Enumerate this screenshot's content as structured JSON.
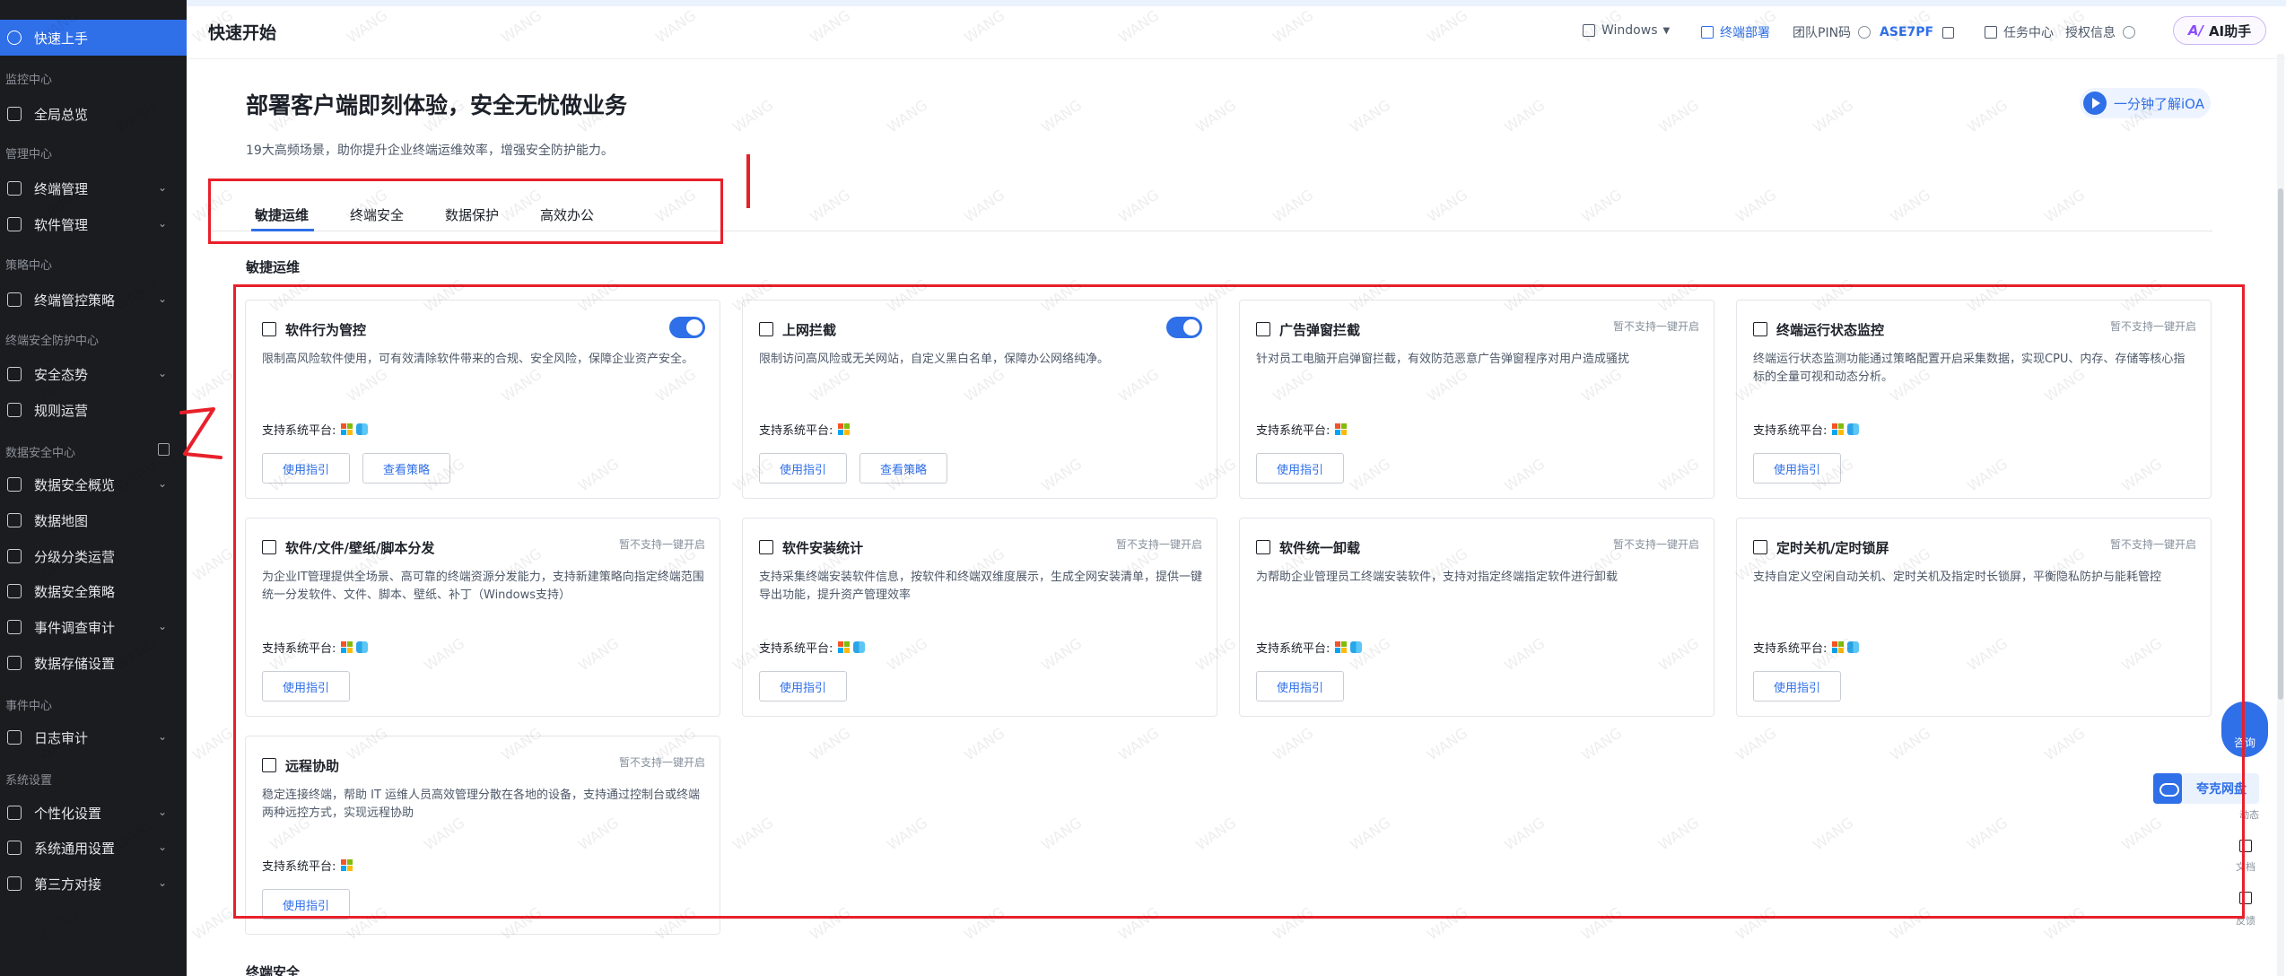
{
  "sidebar": {
    "groups": [
      "监控中心",
      "管理中心",
      "策略中心",
      "终端安全防护中心",
      "数据安全中心",
      "事件中心",
      "系统设置"
    ],
    "items": [
      {
        "label": "快速上手"
      },
      {
        "label": "全局总览"
      },
      {
        "label": "终端管理"
      },
      {
        "label": "软件管理"
      },
      {
        "label": "终端管控策略"
      },
      {
        "label": "安全态势"
      },
      {
        "label": "规则运营"
      },
      {
        "label": "数据安全概览"
      },
      {
        "label": "数据地图"
      },
      {
        "label": "分级分类运营"
      },
      {
        "label": "数据安全策略"
      },
      {
        "label": "事件调查审计"
      },
      {
        "label": "数据存储设置"
      },
      {
        "label": "日志审计"
      },
      {
        "label": "个性化设置"
      },
      {
        "label": "系统通用设置"
      },
      {
        "label": "第三方对接"
      }
    ]
  },
  "header": {
    "title": "快速开始",
    "os_select": "Windows",
    "deploy": "终端部署",
    "pin_label": "团队PIN码",
    "pin_value": "ASE7PF",
    "task_center": "任务中心",
    "license": "授权信息",
    "ai_logo": "A/",
    "ai_label": "AI助手"
  },
  "hero": {
    "title": "部署客户端即刻体验，安全无忧做业务",
    "subtitle": "19大高频场景，助你提升企业终端运维效率，增强安全防护能力。",
    "learn_button": "一分钟了解iOA"
  },
  "tabs": [
    {
      "label": "敏捷运维",
      "active": true
    },
    {
      "label": "终端安全",
      "active": false
    },
    {
      "label": "数据保护",
      "active": false
    },
    {
      "label": "高效办公",
      "active": false
    }
  ],
  "section": {
    "label": "敏捷运维",
    "next_label": "终端安全"
  },
  "common": {
    "platform_label": "支持系统平台:",
    "guide_button": "使用指引",
    "policy_button": "查看策略",
    "not_supported": "暂不支持一键开启"
  },
  "cards": [
    {
      "title": "软件行为管控",
      "desc": "限制高风险软件使用，可有效清除软件带来的合规、安全风险，保障企业资产安全。",
      "toggle": true,
      "mac": true,
      "policy": true
    },
    {
      "title": "上网拦截",
      "desc": "限制访问高风险或无关网站，自定义黑白名单，保障办公网络纯净。",
      "toggle": true,
      "mac": false,
      "policy": true
    },
    {
      "title": "广告弹窗拦截",
      "desc": "针对员工电脑开启弹窗拦截，有效防范恶意广告弹窗程序对用户造成骚扰",
      "toggle": false,
      "mac": false,
      "policy": false
    },
    {
      "title": "终端运行状态监控",
      "desc": "终端运行状态监测功能通过策略配置开启采集数据，实现CPU、内存、存储等核心指标的全量可视和动态分析。",
      "toggle": false,
      "mac": true,
      "policy": false
    },
    {
      "title": "软件/文件/壁纸/脚本分发",
      "desc": "为企业IT管理提供全场景、高可靠的终端资源分发能力，支持新建策略向指定终端范围统一分发软件、文件、脚本、壁纸、补丁（Windows支持）",
      "toggle": false,
      "mac": true,
      "policy": false
    },
    {
      "title": "软件安装统计",
      "desc": "支持采集终端安装软件信息，按软件和终端双维度展示，生成全网安装清单，提供一键导出功能，提升资产管理效率",
      "toggle": false,
      "mac": true,
      "policy": false
    },
    {
      "title": "软件统一卸载",
      "desc": "为帮助企业管理员工终端安装软件，支持对指定终端指定软件进行卸载",
      "toggle": false,
      "mac": true,
      "policy": false
    },
    {
      "title": "定时关机/定时锁屏",
      "desc": "支持自定义空闲自动关机、定时关机及指定时长锁屏，平衡隐私防护与能耗管控",
      "toggle": false,
      "mac": true,
      "policy": false
    },
    {
      "title": "远程协助",
      "desc": "稳定连接终端，帮助 IT 运维人员高效管理分散在各地的设备，支持通过控制台或终端两种远控方式，实现远程协助",
      "toggle": false,
      "mac": false,
      "policy": false
    }
  ],
  "floating": {
    "consult": "咨询",
    "cloud": "夸克网盘",
    "rail": [
      "动态",
      "文档",
      "反馈"
    ]
  },
  "annotations": [
    "1",
    "2"
  ],
  "watermark": "WANG",
  "colors": {
    "accent": "#2f6fe8",
    "sidebar_bg": "#1b1c1f",
    "annotation": "#e8202a"
  }
}
